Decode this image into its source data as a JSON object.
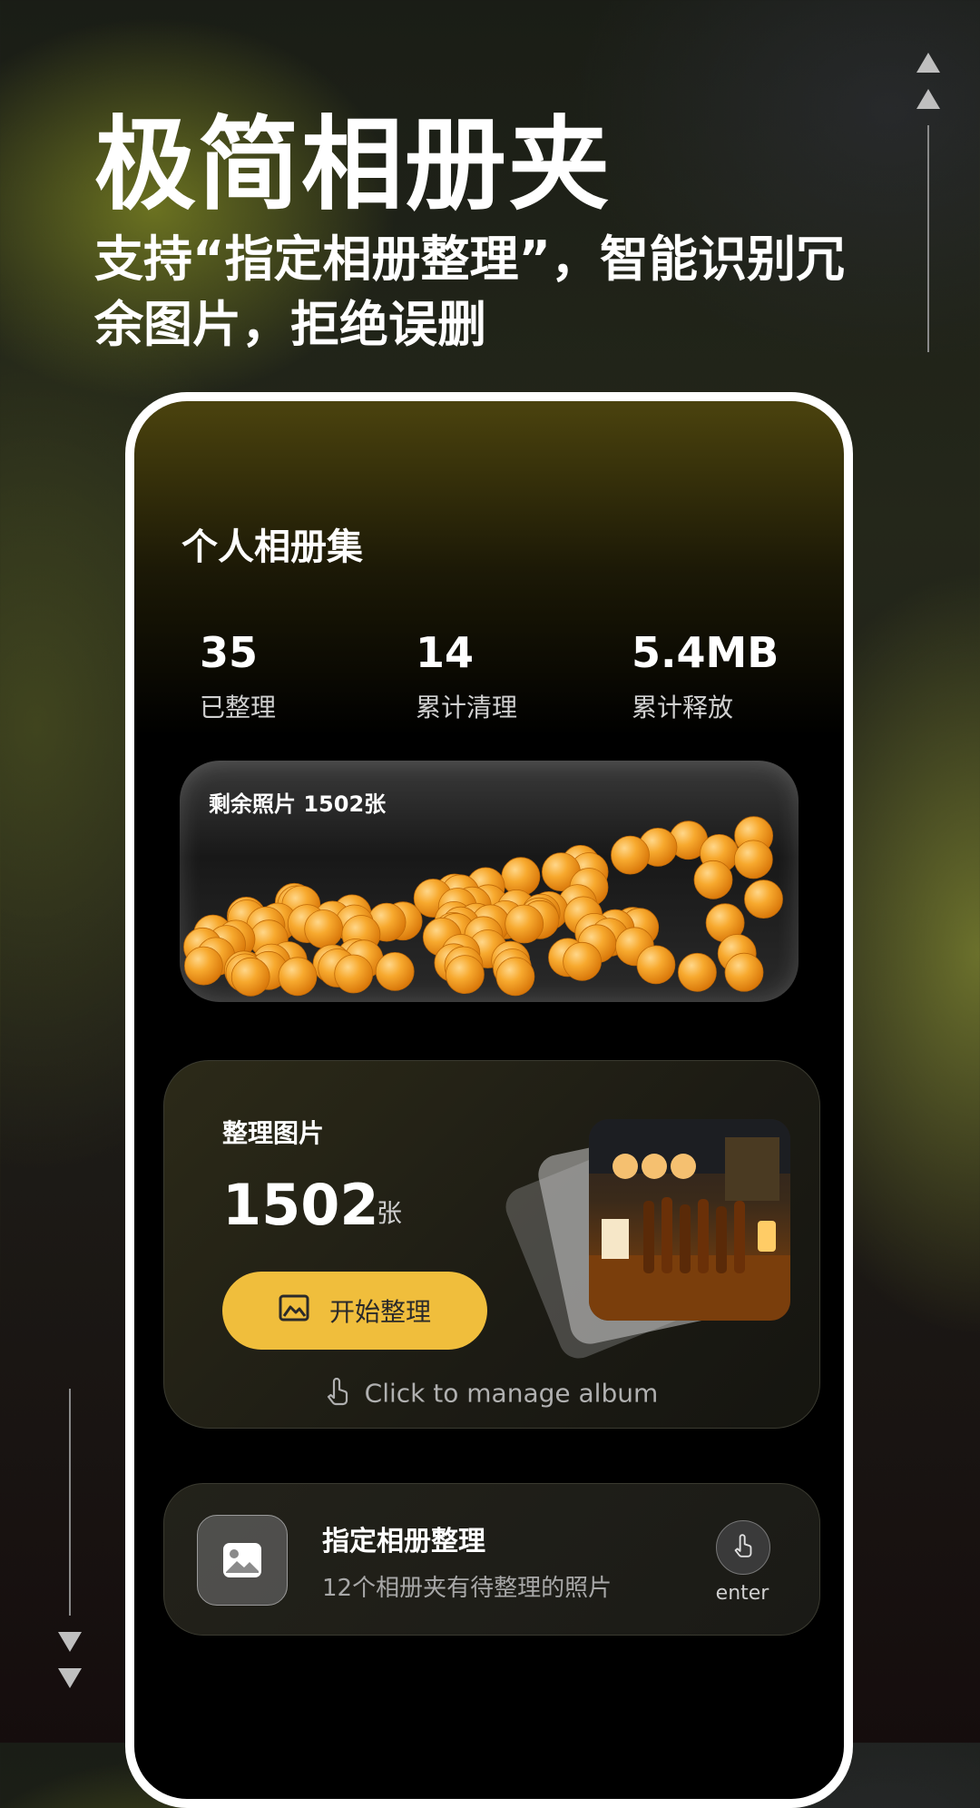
{
  "promo": {
    "title": "极简相册夹",
    "subtitle": "支持“指定相册整理”，智能识别冗余图片，拒绝误删"
  },
  "album": {
    "title": "个人相册集",
    "stats": [
      {
        "value": "35",
        "label": "已整理"
      },
      {
        "value": "14",
        "label": "累计清理"
      },
      {
        "value": "5.4MB",
        "label": "累计释放"
      }
    ],
    "remaining_label": "剩余照片  1502张"
  },
  "manage": {
    "label": "整理图片",
    "count": "1502",
    "unit": "张",
    "start_button": "开始整理",
    "hint": "Click to manage album"
  },
  "folder": {
    "title": "指定相册整理",
    "subtitle": "12个相册夹有待整理的照片",
    "enter_label": "enter"
  },
  "colors": {
    "accent": "#f0be3c",
    "ball": "#f5a623"
  },
  "icons": [
    "arrow-up-icon",
    "arrow-down-icon",
    "image-icon",
    "tap-hand-icon",
    "gallery-icon"
  ]
}
